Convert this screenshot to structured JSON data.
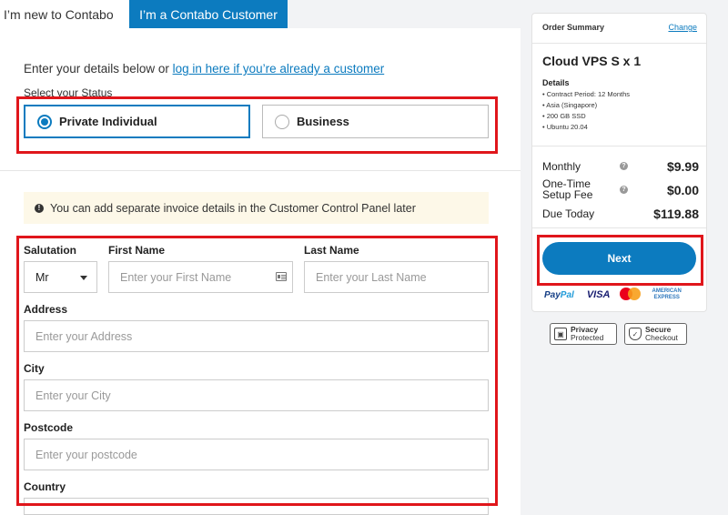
{
  "tabs": [
    {
      "label": "I’m new to Contabo"
    },
    {
      "label": "I’m a Contabo Customer"
    }
  ],
  "intro": {
    "text": "Enter your details below or ",
    "link": "log in here if you’re already a customer"
  },
  "status": {
    "label": "Select your Status",
    "options": [
      {
        "label": "Private Individual",
        "selected": true
      },
      {
        "label": "Business",
        "selected": false
      }
    ]
  },
  "notice": {
    "icon": "info-icon",
    "text": "You can add separate invoice details in the Customer Control Panel later"
  },
  "form": {
    "salutation": {
      "label": "Salutation",
      "value": "Mr"
    },
    "first_name": {
      "label": "First Name",
      "placeholder": "Enter your First Name"
    },
    "last_name": {
      "label": "Last Name",
      "placeholder": "Enter your Last Name"
    },
    "address": {
      "label": "Address",
      "placeholder": "Enter your Address"
    },
    "city": {
      "label": "City",
      "placeholder": "Enter your City"
    },
    "postcode": {
      "label": "Postcode",
      "placeholder": "Enter your postcode"
    },
    "country": {
      "label": "Country"
    }
  },
  "summary": {
    "header": "Order Summary",
    "change": "Change",
    "product": "Cloud VPS S x 1",
    "details_title": "Details",
    "details": [
      "Contract Period: 12 Months",
      "Asia (Singapore)",
      "200 GB SSD",
      "Ubuntu 20.04"
    ],
    "monthly_label": "Monthly",
    "monthly_value": "$9.99",
    "setup_label_1": "One-Time",
    "setup_label_2": "Setup Fee",
    "setup_value": "$0.00",
    "due_label": "Due Today",
    "due_value": "$119.88"
  },
  "next_button": "Next",
  "payments": {
    "paypal_a": "Pay",
    "paypal_b": "Pal",
    "visa": "VISA",
    "amex_1": "AMERICAN",
    "amex_2": "EXPRESS"
  },
  "badges": {
    "privacy_1": "Privacy",
    "privacy_2": "Protected",
    "secure_1": "Secure",
    "secure_2": "Checkout"
  },
  "colors": {
    "accent": "#0c7bbf",
    "highlight": "#e0161b",
    "notice_bg": "#fdf8e8"
  }
}
